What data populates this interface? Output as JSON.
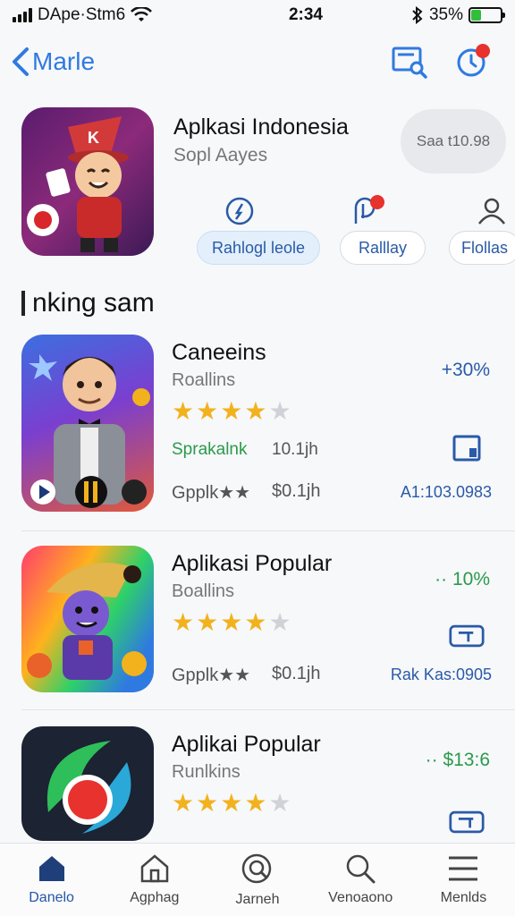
{
  "status": {
    "carrier": "DApe·Stm6",
    "time": "2:34",
    "battery": "35%",
    "battery_level": 0.35
  },
  "nav": {
    "back_label": "Marle"
  },
  "hero": {
    "title": "Aplkasi Indonesia",
    "subtitle": "Sopl Aayes",
    "pill_label": "Saa t10.98",
    "chips": [
      "Rahlogl leole",
      "Ralllay",
      "Flollas"
    ]
  },
  "section": {
    "title": "nking sam"
  },
  "apps": [
    {
      "name": "Caneeins",
      "category": "Roallins",
      "rating": 4,
      "meta1": "Sprakalnk",
      "meta1_value": "10.1jh",
      "meta2": "Gpplk★★",
      "meta2_value": "$0.1jh",
      "rank": "+30%",
      "code": "A1:103.0983"
    },
    {
      "name": "Aplikasi Popular",
      "category": "Boallins",
      "rating": 4,
      "meta2": "Gpplk★★",
      "meta2_value": "$0.1jh",
      "rank": "·· 10%",
      "code": "Rak Kas:0905"
    },
    {
      "name": "Aplikai Popular",
      "category": "Runlkins",
      "rating": 4,
      "rank": "·· $13:6"
    }
  ],
  "tabs": [
    "Danelo",
    "Agphag",
    "Jarneh",
    "Venoaono",
    "Menlds"
  ],
  "colors": {
    "accent": "#2f7ae0",
    "star": "#f2b21d",
    "green": "#2b9a4b",
    "notification": "#e8322e"
  }
}
